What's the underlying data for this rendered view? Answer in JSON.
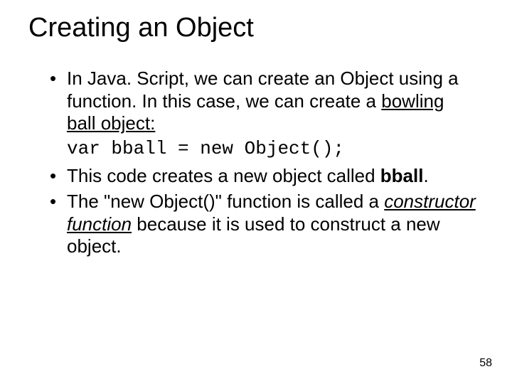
{
  "title": "Creating an Object",
  "bullets": {
    "b1_prefix": "In Java. Script, we can create an Object using a function. In this case, we can create a ",
    "b1_underlined": "bowling ball object:",
    "code": "var bball = new Object();",
    "b2_prefix": "This code creates a new object called ",
    "b2_bold": "bball",
    "b2_suffix": ".",
    "b3_prefix": "The \"new Object()\" function is called a ",
    "b3_emph": "constructor function",
    "b3_suffix": " because it is used to construct a new object."
  },
  "page_number": "58"
}
